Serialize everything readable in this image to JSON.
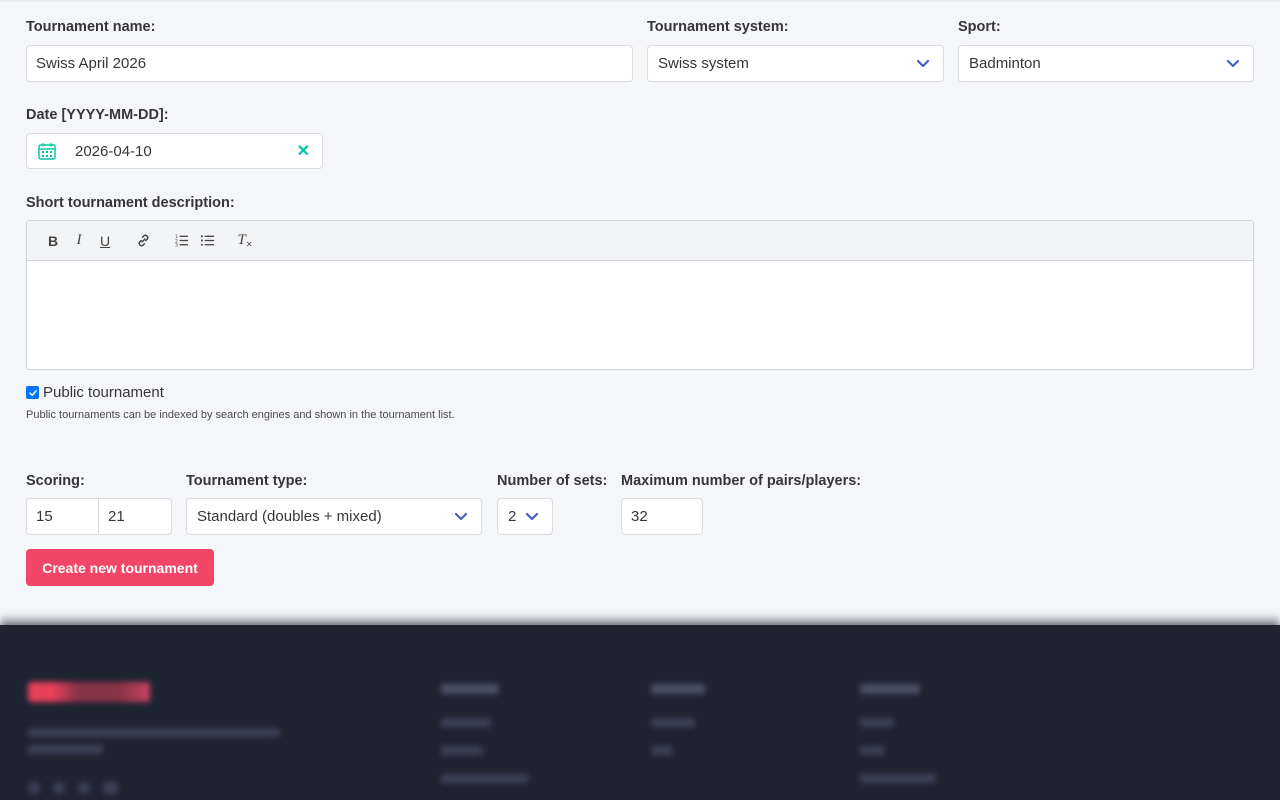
{
  "form": {
    "tournament_name": {
      "label": "Tournament name:",
      "value": "Swiss April 2026"
    },
    "tournament_system": {
      "label": "Tournament system:",
      "value": "Swiss system"
    },
    "sport": {
      "label": "Sport:",
      "value": "Badminton"
    },
    "date": {
      "label": "Date [YYYY-MM-DD]:",
      "value": "2026-04-10"
    },
    "description": {
      "label": "Short tournament description:"
    },
    "public": {
      "label": "Public tournament",
      "checked": true,
      "help": "Public tournaments can be indexed by search engines and shown in the tournament list."
    },
    "scoring": {
      "label": "Scoring:",
      "value_1": "15",
      "value_2": "21"
    },
    "tournament_type": {
      "label": "Tournament type:",
      "value": "Standard (doubles + mixed)"
    },
    "number_of_sets": {
      "label": "Number of sets:",
      "value": "2"
    },
    "max_players": {
      "label": "Maximum number of pairs/players:",
      "value": "32"
    },
    "submit_label": "Create new tournament"
  },
  "toolbar": {
    "bold": "B",
    "italic": "I",
    "underline": "U",
    "clear_format": "T"
  },
  "icons": {
    "select": "chevron-down-icon",
    "date": "calendar-icon",
    "clear": "close-icon"
  },
  "colors": {
    "primary": "#f14668",
    "link": "#485fc7",
    "success": "#00c4a7",
    "footer": "#1f2433"
  }
}
